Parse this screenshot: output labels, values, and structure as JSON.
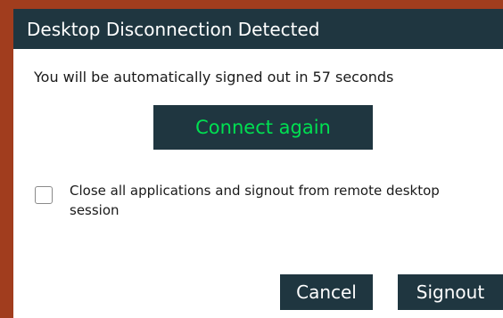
{
  "dialog": {
    "title": "Desktop Disconnection Detected",
    "countdown_message": "You will be automatically signed out in 57 seconds",
    "connect_label": "Connect again",
    "close_apps_checked": false,
    "close_apps_label": "Close all applications and signout from remote desktop session",
    "cancel_label": "Cancel",
    "signout_label": "Signout"
  },
  "colors": {
    "backdrop": "#a13d1e",
    "titlebar": "#1f3640",
    "button_bg": "#1f3640",
    "connect_text": "#00e051",
    "button_text": "#ffffff"
  }
}
